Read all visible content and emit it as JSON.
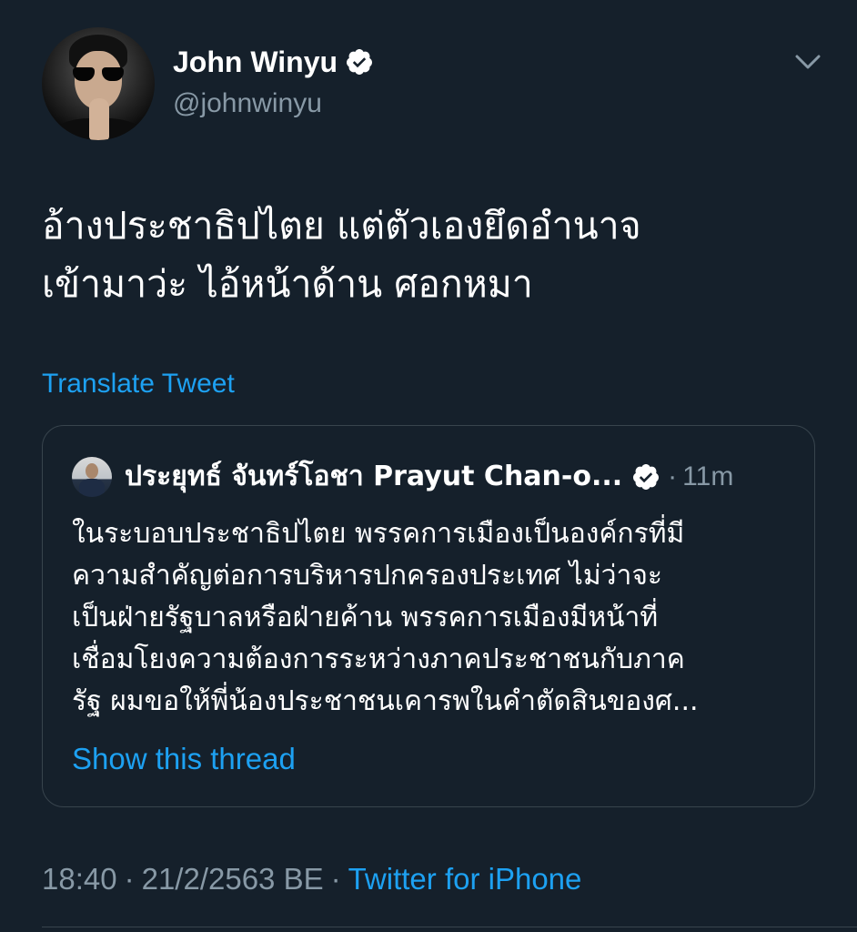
{
  "author": {
    "display_name": "John Winyu",
    "handle": "@johnwinyu",
    "verified": true,
    "avatar_icon": "profile-photo"
  },
  "tweet": {
    "lines": [
      "อ้างประชาธิปไตย แต่ตัวเองยึดอำนาจ",
      "เข้ามาว่ะ ไอ้หน้าด้าน ศอกหมา"
    ],
    "translate_label": "Translate Tweet"
  },
  "quoted": {
    "display_name": "ประยุทธ์ จันทร์โอชา Prayut Chan-o...",
    "verified": true,
    "separator": "·",
    "time": "11m",
    "lines": [
      "ในระบอบประชาธิปไตย พรรคการเมืองเป็นองค์กรที่มี",
      "ความสำคัญต่อการบริหารปกครองประเทศ ไม่ว่าจะ",
      "เป็นฝ่ายรัฐบาลหรือฝ่ายค้าน พรรคการเมืองมีหน้าที่",
      "เชื่อมโยงความต้องการระหว่างภาคประชาชนกับภาค",
      "รัฐ ผมขอให้พี่น้องประชาชนเคารพในคำตัดสินของศ..."
    ],
    "show_thread_label": "Show this thread"
  },
  "meta": {
    "time": "18:40",
    "separator": "·",
    "date": "21/2/2563 BE",
    "source": "Twitter for iPhone"
  },
  "colors": {
    "background": "#15202b",
    "link": "#1da1f2",
    "secondary_text": "#8899a6",
    "border": "#38444d"
  }
}
